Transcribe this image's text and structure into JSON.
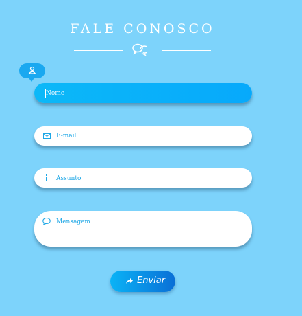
{
  "header": {
    "title": "FALE CONOSCO",
    "divider_icon": "chat-bubbles-icon"
  },
  "form": {
    "name_field": {
      "placeholder": "Nome",
      "icon": "user-icon"
    },
    "email_field": {
      "placeholder": "E-mail",
      "icon": "envelope-icon"
    },
    "subject_field": {
      "placeholder": "Assunto",
      "icon": "info-icon"
    },
    "message_field": {
      "placeholder": "Mensagem",
      "icon": "speech-bubble-icon"
    },
    "submit": {
      "label": "Enviar",
      "icon": "share-arrow-icon"
    }
  },
  "colors": {
    "background": "#7dd3fb",
    "accent": "#07a9fb",
    "icon": "#1ea7e6",
    "button_start": "#0ab3f6",
    "button_end": "#0a6fd6"
  }
}
